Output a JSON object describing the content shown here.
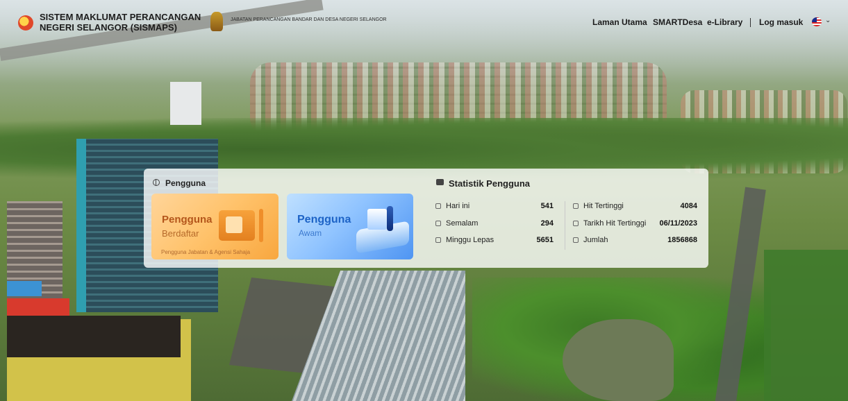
{
  "header": {
    "title_line1": "SISTEM MAKLUMAT PERANCANGAN",
    "title_line2": "NEGERI SELANGOR (SISMAPS)",
    "department": "JABATAN PERANCANGAN BANDAR DAN DESA NEGERI SELANGOR",
    "nav": [
      "Laman Utama",
      "SMARTDesa",
      "e-Library",
      "Log masuk"
    ]
  },
  "users": {
    "title": "Pengguna",
    "registered": {
      "line1": "Pengguna",
      "line2": "Berdaftar",
      "note": "Pengguna Jabatan & Agensi Sahaja"
    },
    "public": {
      "line1": "Pengguna",
      "line2": "Awam"
    }
  },
  "stats": {
    "title": "Statistik Pengguna",
    "left": [
      {
        "label": "Hari ini",
        "value": "541",
        "icon": "person-icon"
      },
      {
        "label": "Semalam",
        "value": "294",
        "icon": "calendar-icon"
      },
      {
        "label": "Minggu Lepas",
        "value": "5651",
        "icon": "chart-icon"
      }
    ],
    "right": [
      {
        "label": "Hit Tertinggi",
        "value": "4084",
        "icon": "trophy-icon"
      },
      {
        "label": "Tarikh Hit Tertinggi",
        "value": "06/11/2023",
        "icon": "date-icon"
      },
      {
        "label": "Jumlah",
        "value": "1856868",
        "icon": "sum-icon"
      }
    ]
  },
  "colors": {
    "registered_card": "#ffc26a",
    "public_card": "#8fc3ff"
  }
}
